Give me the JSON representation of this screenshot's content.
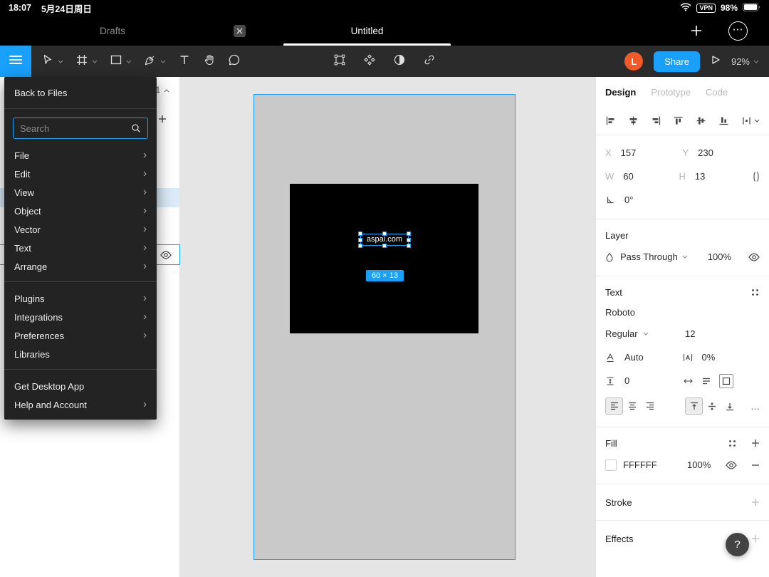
{
  "colors": {
    "accent": "#18a0fb",
    "toolbar_bg": "#2b2b2b",
    "menu_bg": "#232323",
    "canvas_bg": "#e5e5e5",
    "frame_fill": "#c9c9c9",
    "rect_fill": "#000000",
    "avatar": "#f05a28",
    "panel_bg": "#ffffff"
  },
  "status_bar": {
    "time": "18:07",
    "date": "5月24日周日",
    "vpn_label": "VPN",
    "battery": "98%"
  },
  "tab_bar": {
    "drafts_label": "Drafts",
    "active_tab_label": "Untitled"
  },
  "toolbar": {
    "avatar_initial": "L",
    "share_label": "Share",
    "zoom": "92%"
  },
  "menu": {
    "back_label": "Back to Files",
    "search_placeholder": "Search",
    "items": [
      {
        "label": "File"
      },
      {
        "label": "Edit"
      },
      {
        "label": "View"
      },
      {
        "label": "Object"
      },
      {
        "label": "Vector"
      },
      {
        "label": "Text"
      },
      {
        "label": "Arrange"
      }
    ],
    "items2": [
      {
        "label": "Plugins"
      },
      {
        "label": "Integrations"
      },
      {
        "label": "Preferences"
      },
      {
        "label": "Libraries"
      }
    ],
    "items3": [
      {
        "label": "Get Desktop App"
      },
      {
        "label": "Help and Account"
      }
    ]
  },
  "layers_panel": {
    "page_indicator": "1"
  },
  "canvas": {
    "selected_text": "aspai.com",
    "size_badge": "60 × 13"
  },
  "inspector": {
    "tabs": {
      "design": "Design",
      "prototype": "Prototype",
      "code": "Code"
    },
    "position": {
      "x_label": "X",
      "x_value": "157",
      "y_label": "Y",
      "y_value": "230",
      "w_label": "W",
      "w_value": "60",
      "h_label": "H",
      "h_value": "13",
      "rotation": "0°"
    },
    "layer": {
      "title": "Layer",
      "blend_mode": "Pass Through",
      "opacity": "100%"
    },
    "text": {
      "title": "Text",
      "font_family": "Roboto",
      "font_style": "Regular",
      "font_size": "12",
      "line_height": "Auto",
      "letter_spacing": "0%",
      "paragraph_spacing": "0"
    },
    "fill": {
      "title": "Fill",
      "hex": "FFFFFF",
      "opacity": "100%"
    },
    "stroke": {
      "title": "Stroke"
    },
    "effects": {
      "title": "Effects"
    }
  },
  "icons_text": {
    "ellipsis": "⋯",
    "more": "…",
    "help": "?"
  }
}
